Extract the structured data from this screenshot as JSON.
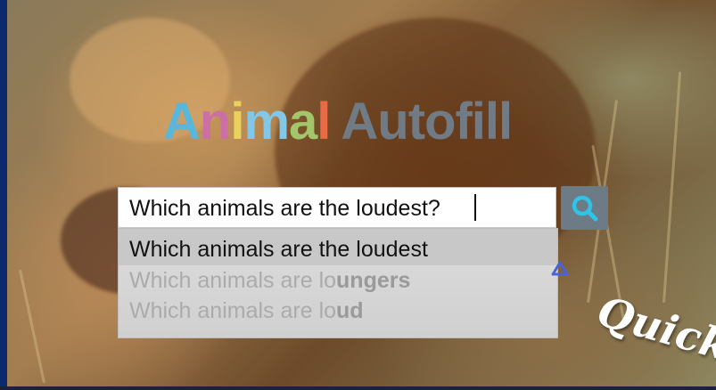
{
  "title": {
    "letters": [
      {
        "ch": "A",
        "color": "#59b7d9"
      },
      {
        "ch": "n",
        "color": "#cc6fa5"
      },
      {
        "ch": "i",
        "color": "#e9d15c"
      },
      {
        "ch": "m",
        "color": "#83c7e6"
      },
      {
        "ch": "a",
        "color": "#a3c56b"
      },
      {
        "ch": "l",
        "color": "#ea6a45"
      }
    ],
    "word2": "Autofill",
    "word2_color": "#707b85"
  },
  "search": {
    "value": "Which animals are the loudest?",
    "button_icon": "search-icon",
    "button_color": "#6c7b86",
    "icon_color": "#2fc3e8"
  },
  "suggestions": [
    {
      "prefix": "Which animals are the loudest",
      "suffix": ""
    },
    {
      "prefix": "Which animals are lo",
      "suffix": "ungers"
    },
    {
      "prefix": "Which animals are lo",
      "suffix": "ud"
    }
  ],
  "pointer_icon": "cursor-triangle-icon",
  "overlay_text": "Quick"
}
